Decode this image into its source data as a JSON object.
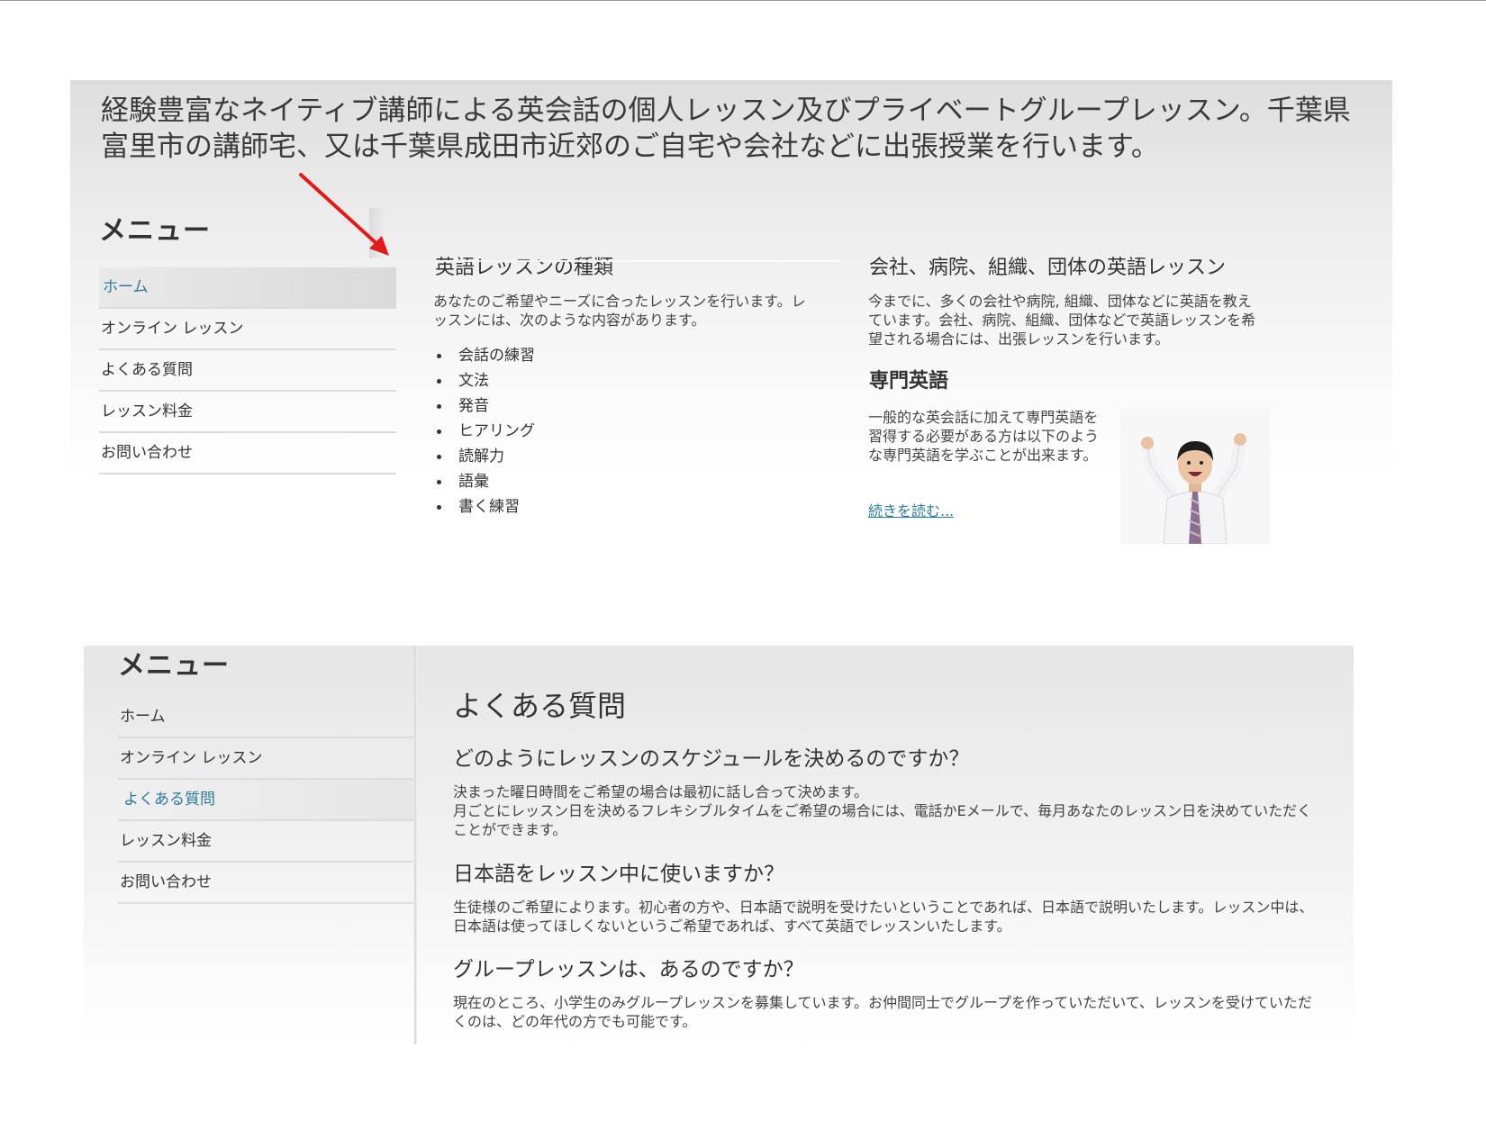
{
  "panel1": {
    "tagline": "経験豊富なネイティブ講師による英会話の個人レッスン及びプライベートグループレッスン。千葉県富里市の講師宅、又は千葉県成田市近郊のご自宅や会社などに出張授業を行います。",
    "menu": {
      "title": "メニュー",
      "items": [
        {
          "label": "ホーム"
        },
        {
          "label": "オンライン レッスン"
        },
        {
          "label": "よくある質問"
        },
        {
          "label": "レッスン料金"
        },
        {
          "label": "お問い合わせ"
        }
      ],
      "active_index": 0
    },
    "lesson_types": {
      "title": "英語レッスンの種類",
      "intro": "あなたのご希望やニーズに合ったレッスンを行います。レッスンには、次のような内容があります。",
      "items": [
        "会話の練習",
        "文法",
        "発音",
        "ヒアリング",
        "読解力",
        "語彙",
        "書く練習"
      ]
    },
    "corporate": {
      "title": "会社、病院、組織、団体の英語レッスン",
      "text": "今までに、多くの会社や病院, 組織、団体などに英語を教えています。会社、病院、組織、団体などで英語レッスンを希望される場合には、出張レッスンを行います。"
    },
    "specialized": {
      "title": "専門英語",
      "text": "一般的な英会話に加えて専門英語を習得する必要がある方は以下のような専門英語を学ぶことが出来ます。",
      "read_more": "続きを読む..."
    }
  },
  "panel2": {
    "menu": {
      "title": "メニュー",
      "items": [
        {
          "label": "ホーム"
        },
        {
          "label": "オンライン レッスン"
        },
        {
          "label": "よくある質問"
        },
        {
          "label": "レッスン料金"
        },
        {
          "label": "お問い合わせ"
        }
      ],
      "active_index": 2
    },
    "faq": {
      "title": "よくある質問",
      "questions": [
        {
          "q": "どのようにレッスンのスケジュールを決めるのですか？",
          "a": "決まった曜日時間をご希望の場合は最初に話し合って決めます。\n月ごとにレッスン日を決めるフレキシブルタイムをご希望の場合には、電話かEメールで、毎月あなたのレッスン日を決めていただくことができます。"
        },
        {
          "q": "日本語をレッスン中に使いますか？",
          "a": "生徒様のご希望によります。初心者の方や、日本語で説明を受けたいということであれば、日本語で説明いたします。レッスン中は、日本語は使ってほしくないというご希望であれば、すべて英語でレッスンいたします。"
        },
        {
          "q": "グループレッスンは、あるのですか？",
          "a": "現在のところ、小学生のみグループレッスンを募集しています。お仲間同士でグループを作っていただいて、レッスンを受けていただくのは、どの年代の方でも可能です。"
        }
      ]
    }
  },
  "colors": {
    "link": "#2f7a95",
    "annotation_arrow": "#e01b1b"
  }
}
